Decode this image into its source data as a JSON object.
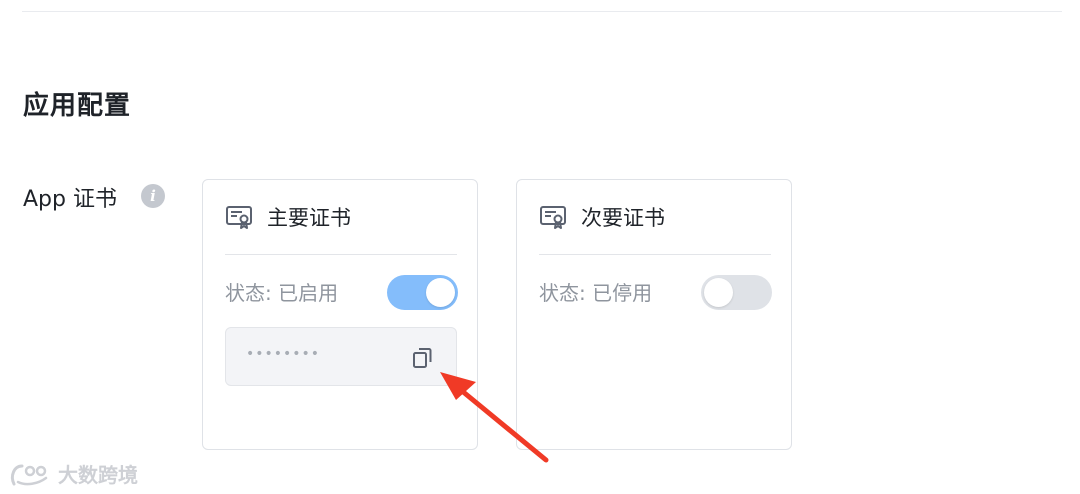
{
  "section": {
    "title": "应用配置"
  },
  "field": {
    "label": "App 证书",
    "info_icon_glyph": "i"
  },
  "cards": [
    {
      "title": "主要证书",
      "status": "状态: 已启用",
      "enabled": true,
      "secret_masked": "••••••••",
      "icon": "certificate-icon",
      "copy_icon": "copy-icon"
    },
    {
      "title": "次要证书",
      "status": "状态: 已停用",
      "enabled": false,
      "icon": "certificate-icon"
    }
  ],
  "colors": {
    "toggle_on": "#84bdfb",
    "toggle_off": "#dfe2e7",
    "annotation_arrow": "#f03a26"
  },
  "watermark": {
    "text": "大数跨境"
  }
}
